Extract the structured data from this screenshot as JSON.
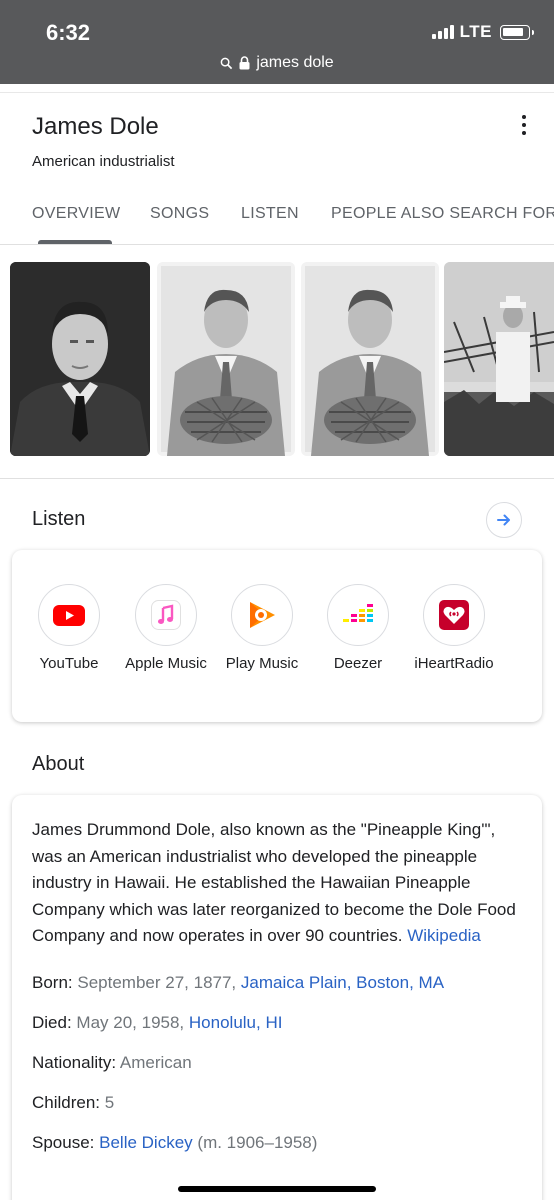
{
  "status": {
    "time": "6:32",
    "network": "LTE"
  },
  "address_bar": {
    "query": "james dole"
  },
  "entity": {
    "title": "James Dole",
    "subtitle": "American industrialist"
  },
  "tabs": [
    "OVERVIEW",
    "SONGS",
    "LISTEN",
    "PEOPLE ALSO SEARCH FOR"
  ],
  "listen": {
    "title": "Listen",
    "providers": [
      {
        "label": "YouTube",
        "icon": "youtube-icon",
        "color": "#ff0000"
      },
      {
        "label": "Apple Music",
        "icon": "apple-music-icon",
        "color": "#fa57c1"
      },
      {
        "label": "Play Music",
        "icon": "play-music-icon",
        "color": "#ff6d00"
      },
      {
        "label": "Deezer",
        "icon": "deezer-icon",
        "color": "#ff0092"
      },
      {
        "label": "iHeartRadio",
        "icon": "iheartradio-icon",
        "color": "#c6002b"
      }
    ]
  },
  "about": {
    "title": "About",
    "description": "James Drummond Dole, also known as the \"Pineapple King'\", was an American industrialist who developed the pineapple industry in Hawaii. He established the Hawaiian Pineapple Company which was later reorganized to become the Dole Food Company and now operates in over 90 countries.",
    "source": "Wikipedia",
    "facts": {
      "born": {
        "label": "Born:",
        "value": "September 27, 1877,",
        "link": "Jamaica Plain, Boston, MA"
      },
      "died": {
        "label": "Died:",
        "value": "May 20, 1958,",
        "link": "Honolulu, HI"
      },
      "nationality": {
        "label": "Nationality:",
        "value": "American"
      },
      "children": {
        "label": "Children:",
        "value": "5"
      },
      "spouse": {
        "label": "Spouse:",
        "link": "Belle Dickey",
        "value": "(m. 1906–1958)"
      }
    }
  },
  "colors": {
    "link": "#2962c4",
    "status_bar": "#58595b",
    "muted": "#70757a"
  }
}
